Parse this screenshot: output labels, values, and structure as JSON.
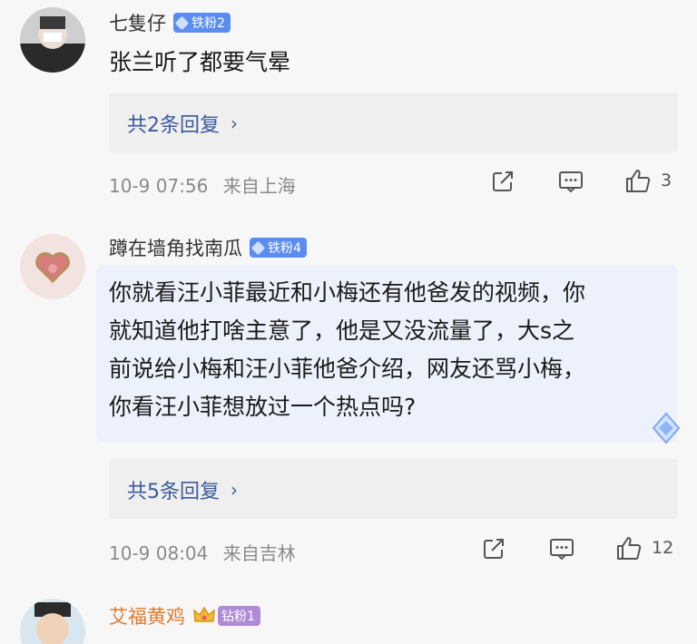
{
  "comments": [
    {
      "username": "七隻仔",
      "badge": "铁粉2",
      "text": "张兰听了都要气晕",
      "replies_label": "共2条回复",
      "date": "10-9 07:56",
      "location": "来自上海",
      "like_count": "3"
    },
    {
      "username": "蹲在墙角找南瓜",
      "badge": "铁粉4",
      "text_lines": [
        "你就看汪小菲最近和小梅还有他爸发的视频，你",
        "就知道他打啥主意了，他是又没流量了，大s之",
        "前说给小梅和汪小菲他爸介绍，网友还骂小梅，",
        "你看汪小菲想放过一个热点吗?"
      ],
      "replies_label": "共5条回复",
      "date": "10-9 08:04",
      "location": "来自吉林",
      "like_count": "12"
    },
    {
      "username": "艾福黄鸡",
      "badge": "钻粉1"
    }
  ],
  "colors": {
    "badge_blue": "#5b8df0",
    "badge_purple": "#b08bd8",
    "username_orange": "#e07a2a",
    "reply_link": "#3b5a99"
  },
  "icons": [
    "share-icon",
    "comment-icon",
    "thumbs-up-icon",
    "sparkle-icon",
    "crown-icon"
  ]
}
